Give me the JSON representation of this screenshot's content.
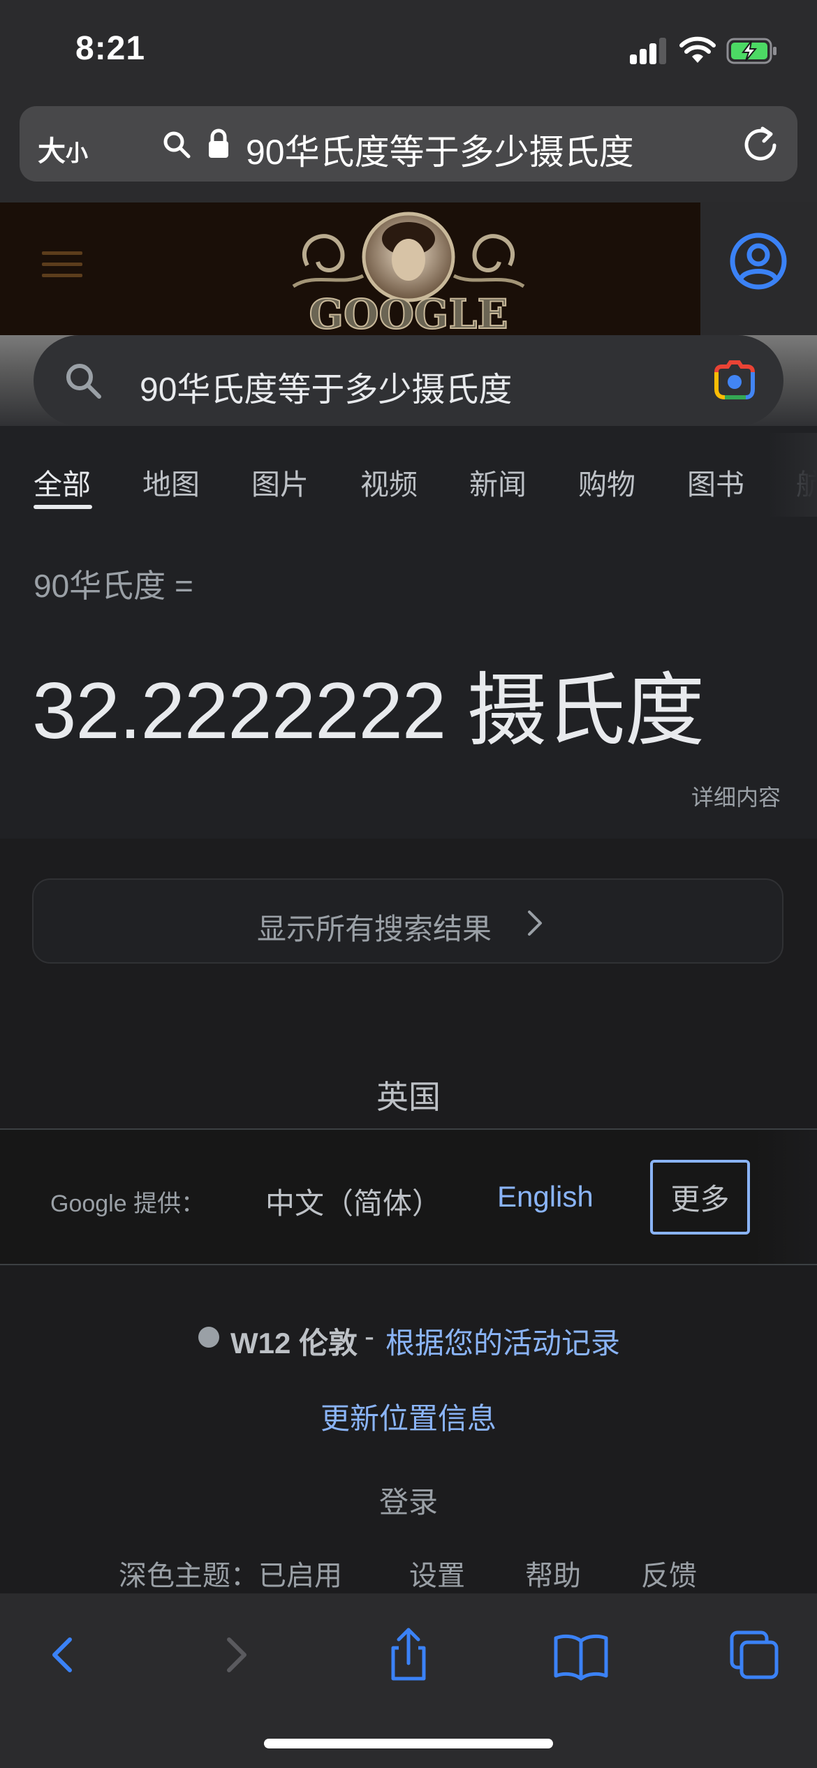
{
  "status_bar": {
    "time": "8:21"
  },
  "browser": {
    "text_size_label": "大",
    "text_size_small": "小",
    "url_text": "90华氏度等于多少摄氏度"
  },
  "search": {
    "query": "90华氏度等于多少摄氏度"
  },
  "tabs": [
    {
      "label": "全部",
      "active": true
    },
    {
      "label": "地图"
    },
    {
      "label": "图片"
    },
    {
      "label": "视频"
    },
    {
      "label": "新闻"
    },
    {
      "label": "购物"
    },
    {
      "label": "图书"
    },
    {
      "label": "航"
    }
  ],
  "conversion": {
    "from": "90华氏度 =",
    "result": "32.2222222 摄氏度",
    "details": "详细内容"
  },
  "show_all": {
    "label": "显示所有搜索结果"
  },
  "footer": {
    "country": "英国",
    "offered_in": "Google 提供：",
    "languages": [
      "中文（简体）",
      "English"
    ],
    "more": "更多",
    "location_place": "W12 伦敦",
    "location_sep": "-",
    "location_source": "根据您的活动记录",
    "update_location": "更新位置信息",
    "sign_in": "登录",
    "links": [
      "深色主题：已启用",
      "设置",
      "帮助",
      "反馈"
    ]
  },
  "colors": {
    "link": "#8ab4f8",
    "accent_blue": "#3b82f6",
    "battery_green": "#4cd964"
  }
}
